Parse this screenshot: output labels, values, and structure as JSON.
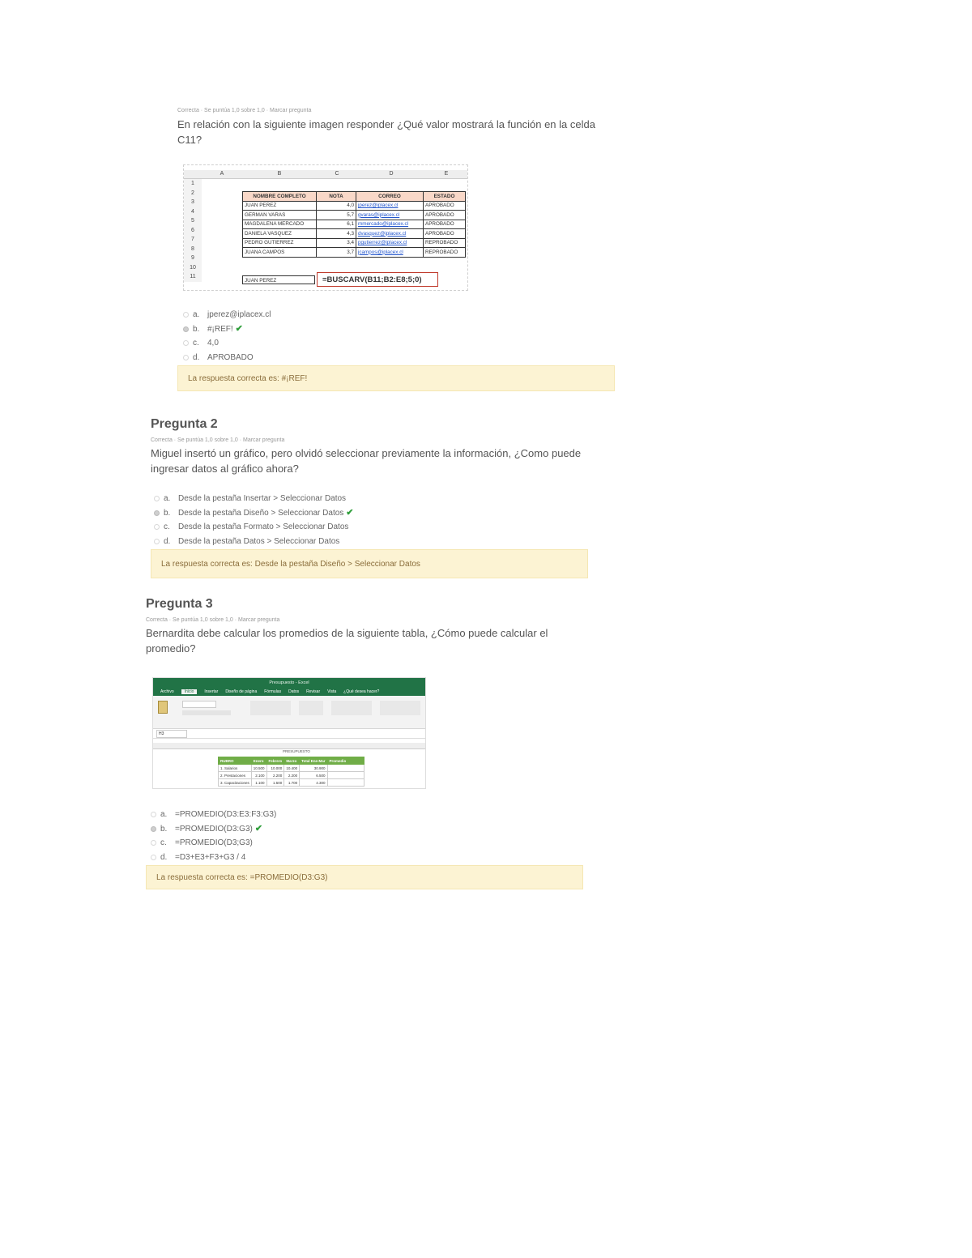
{
  "q1": {
    "meta": "Correcta · Se puntúa 1,0 sobre 1,0 · Marcar pregunta",
    "text_line1": "En relación con la siguiente imagen responder ¿Qué valor mostrará la función en la celda",
    "text_line2": "C11?",
    "sheet": {
      "col_labels": [
        "A",
        "B",
        "C",
        "D",
        "E"
      ],
      "row_numbers": [
        "1",
        "2",
        "3",
        "4",
        "5",
        "6",
        "7",
        "8",
        "9",
        "10",
        "11"
      ],
      "headers": [
        "NOMBRE COMPLETO",
        "NOTA",
        "CORREO",
        "ESTADO"
      ],
      "rows": [
        [
          "JUAN PEREZ",
          "4,0",
          "jperez@iplacex.cl",
          "APROBADO"
        ],
        [
          "GERMAN VARAS",
          "5,7",
          "gvaras@iplacex.cl",
          "APROBADO"
        ],
        [
          "MAGDALENA MERCADO",
          "6,1",
          "mmercado@iplacex.cl",
          "APROBADO"
        ],
        [
          "DANIELA VASQUEZ",
          "4,3",
          "dvasquez@iplacex.cl",
          "APROBADO"
        ],
        [
          "PEDRO GUTIERREZ",
          "3,4",
          "pgutierrez@iplacex.cl",
          "REPROBADO"
        ],
        [
          "JUANA CAMPOS",
          "3,7",
          "jcampos@iplacex.cl",
          "REPROBADO"
        ]
      ],
      "b11": "JUAN PEREZ",
      "formula": "=BUSCARV(B11;B2:E8;5;0)"
    },
    "options": [
      {
        "letter": "a.",
        "text": "jperez@iplacex.cl",
        "selected": false,
        "correct": false
      },
      {
        "letter": "b.",
        "text": "#¡REF!",
        "selected": true,
        "correct": true
      },
      {
        "letter": "c.",
        "text": "4,0",
        "selected": false,
        "correct": false
      },
      {
        "letter": "d.",
        "text": "APROBADO",
        "selected": false,
        "correct": false
      }
    ],
    "feedback": "La respuesta correcta es: #¡REF!"
  },
  "q2": {
    "title": "Pregunta 2",
    "meta": "Correcta · Se puntúa 1,0 sobre 1,0 · Marcar pregunta",
    "text_line1": "Miguel insertó un gráfico, pero olvidó seleccionar previamente la información, ¿Como puede",
    "text_line2": "ingresar datos al gráfico ahora?",
    "options": [
      {
        "letter": "a.",
        "text": "Desde la pestaña Insertar > Seleccionar Datos",
        "selected": false,
        "correct": false
      },
      {
        "letter": "b.",
        "text": "Desde la pestaña Diseño > Seleccionar Datos",
        "selected": true,
        "correct": true
      },
      {
        "letter": "c.",
        "text": "Desde la pestaña Formato > Seleccionar Datos",
        "selected": false,
        "correct": false
      },
      {
        "letter": "d.",
        "text": "Desde la pestaña Datos > Seleccionar Datos",
        "selected": false,
        "correct": false
      }
    ],
    "feedback": "La respuesta correcta es: Desde la pestaña Diseño > Seleccionar Datos"
  },
  "q3": {
    "title": "Pregunta 3",
    "meta": "Correcta · Se puntúa 1,0 sobre 1,0 · Marcar pregunta",
    "text_line1": "Bernardita debe calcular los promedios de la siguiente tabla, ¿Cómo puede calcular el",
    "text_line2": "promedio?",
    "excel": {
      "window_title": "Presupuesto - Excel",
      "tabs": [
        "Archivo",
        "Inicio",
        "Insertar",
        "Diseño de página",
        "Fórmulas",
        "Datos",
        "Revisar",
        "Vista",
        "¿Qué desea hacer?"
      ],
      "name_box": "H3",
      "sheet_title": "PRESUPUESTO",
      "headers": [
        "RUBRO",
        "Enero",
        "Febrero",
        "Marzo",
        "Total Ene-Mar",
        "Promedio"
      ],
      "rows": [
        [
          "1. Salarios",
          "10.500",
          "10.000",
          "10.400",
          "30.900",
          ""
        ],
        [
          "2. Prestaciones",
          "2.100",
          "2.200",
          "2.200",
          "6.500",
          ""
        ],
        [
          "3. Capacitaciones",
          "1.100",
          "1.500",
          "1.700",
          "4.300",
          ""
        ]
      ]
    },
    "options": [
      {
        "letter": "a.",
        "text": "=PROMEDIO(D3:E3:F3:G3)",
        "selected": false,
        "correct": false
      },
      {
        "letter": "b.",
        "text": "=PROMEDIO(D3:G3)",
        "selected": true,
        "correct": true
      },
      {
        "letter": "c.",
        "text": "=PROMEDIO(D3;G3)",
        "selected": false,
        "correct": false
      },
      {
        "letter": "d.",
        "text": "=D3+E3+F3+G3 / 4",
        "selected": false,
        "correct": false
      }
    ],
    "feedback": "La respuesta correcta es: =PROMEDIO(D3:G3)"
  },
  "colors": {
    "correct_check": "#2e9e3a",
    "feedback_bg": "#fcf3d3",
    "excel_green": "#217346",
    "table_header": "#70ad47"
  }
}
